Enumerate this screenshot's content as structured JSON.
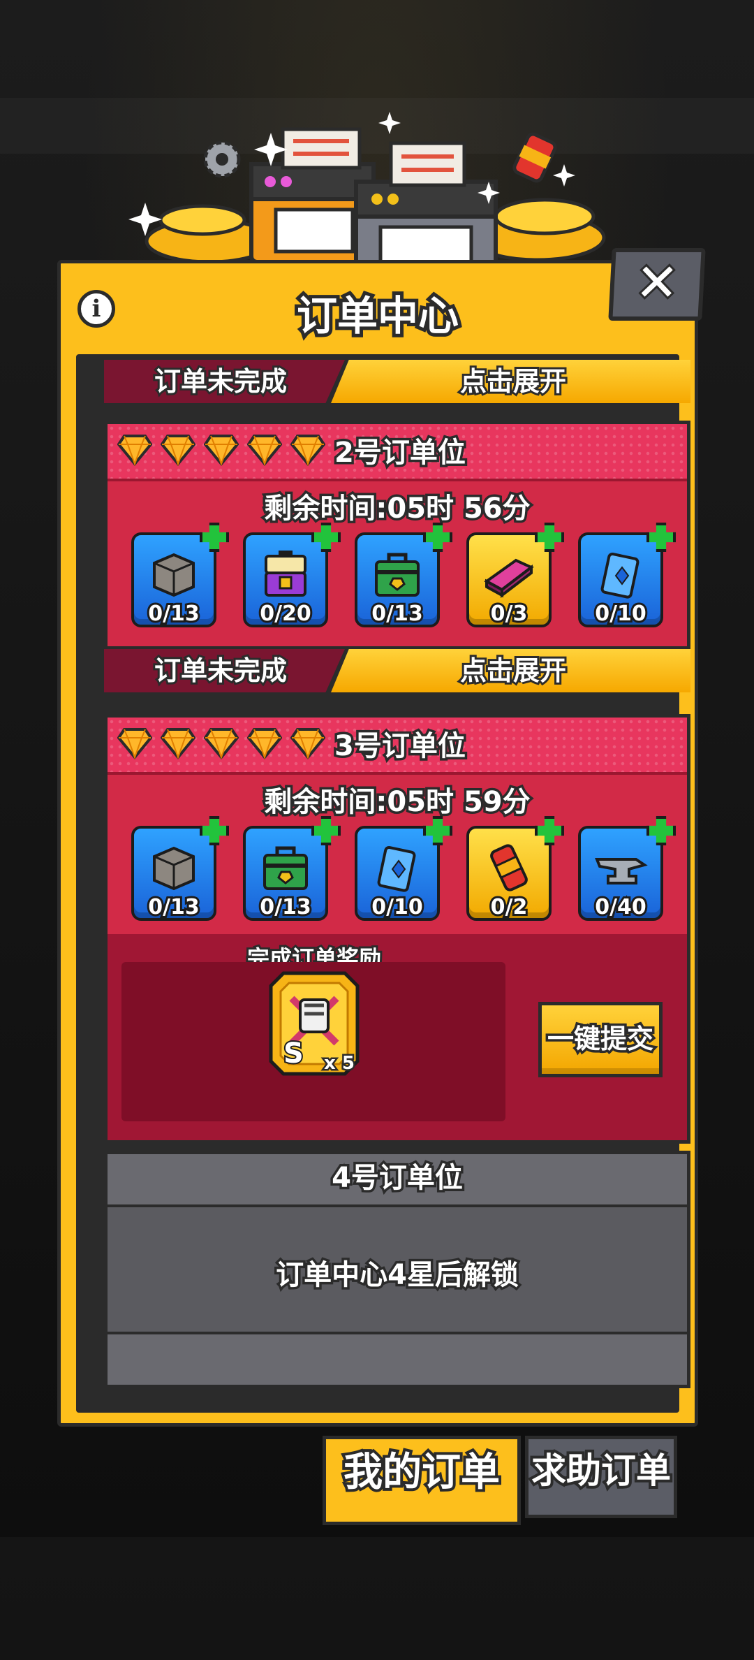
{
  "dialog": {
    "title": "订单中心",
    "info_icon": "info-icon",
    "close_icon": "close-icon"
  },
  "collapsed_label": "订单未完成",
  "expand_label": "点击展开",
  "orders": [
    {
      "slot": "2号订单位",
      "stars": 5,
      "timer": "剩余时间:05时 56分",
      "items": [
        {
          "icon": "stone-block-icon",
          "count": "0/13",
          "frame": "blue"
        },
        {
          "icon": "purple-chest-icon",
          "count": "0/20",
          "frame": "blue"
        },
        {
          "icon": "green-toolbox-icon",
          "count": "0/13",
          "frame": "blue"
        },
        {
          "icon": "pink-ingot-icon",
          "count": "0/3",
          "frame": "gold"
        },
        {
          "icon": "blue-card-icon",
          "count": "0/10",
          "frame": "blue"
        }
      ]
    },
    {
      "slot": "3号订单位",
      "stars": 5,
      "timer": "剩余时间:05时 59分",
      "items": [
        {
          "icon": "stone-block-icon",
          "count": "0/13",
          "frame": "blue"
        },
        {
          "icon": "green-toolbox-icon",
          "count": "0/13",
          "frame": "blue"
        },
        {
          "icon": "blue-card-icon",
          "count": "0/10",
          "frame": "blue"
        },
        {
          "icon": "red-canister-icon",
          "count": "0/2",
          "frame": "gold"
        },
        {
          "icon": "anvil-icon",
          "count": "0/40",
          "frame": "blue"
        }
      ],
      "reward_label": "完成订单奖励",
      "reward_icon": "s-rank-hero-card-icon",
      "reward_qty": "x 5",
      "submit_label": "一键提交"
    }
  ],
  "locked_slot": {
    "slot": "4号订单位",
    "message": "订单中心4星后解锁"
  },
  "tabs": [
    {
      "label": "我的订单",
      "active": true
    },
    {
      "label": "求助订单",
      "active": false
    }
  ],
  "colors": {
    "panel": "#fdbf1c",
    "card_red": "#d22a47",
    "item_blue": "#1a63d8",
    "item_gold": "#f2a900",
    "locked_gray": "#5b5b60"
  }
}
